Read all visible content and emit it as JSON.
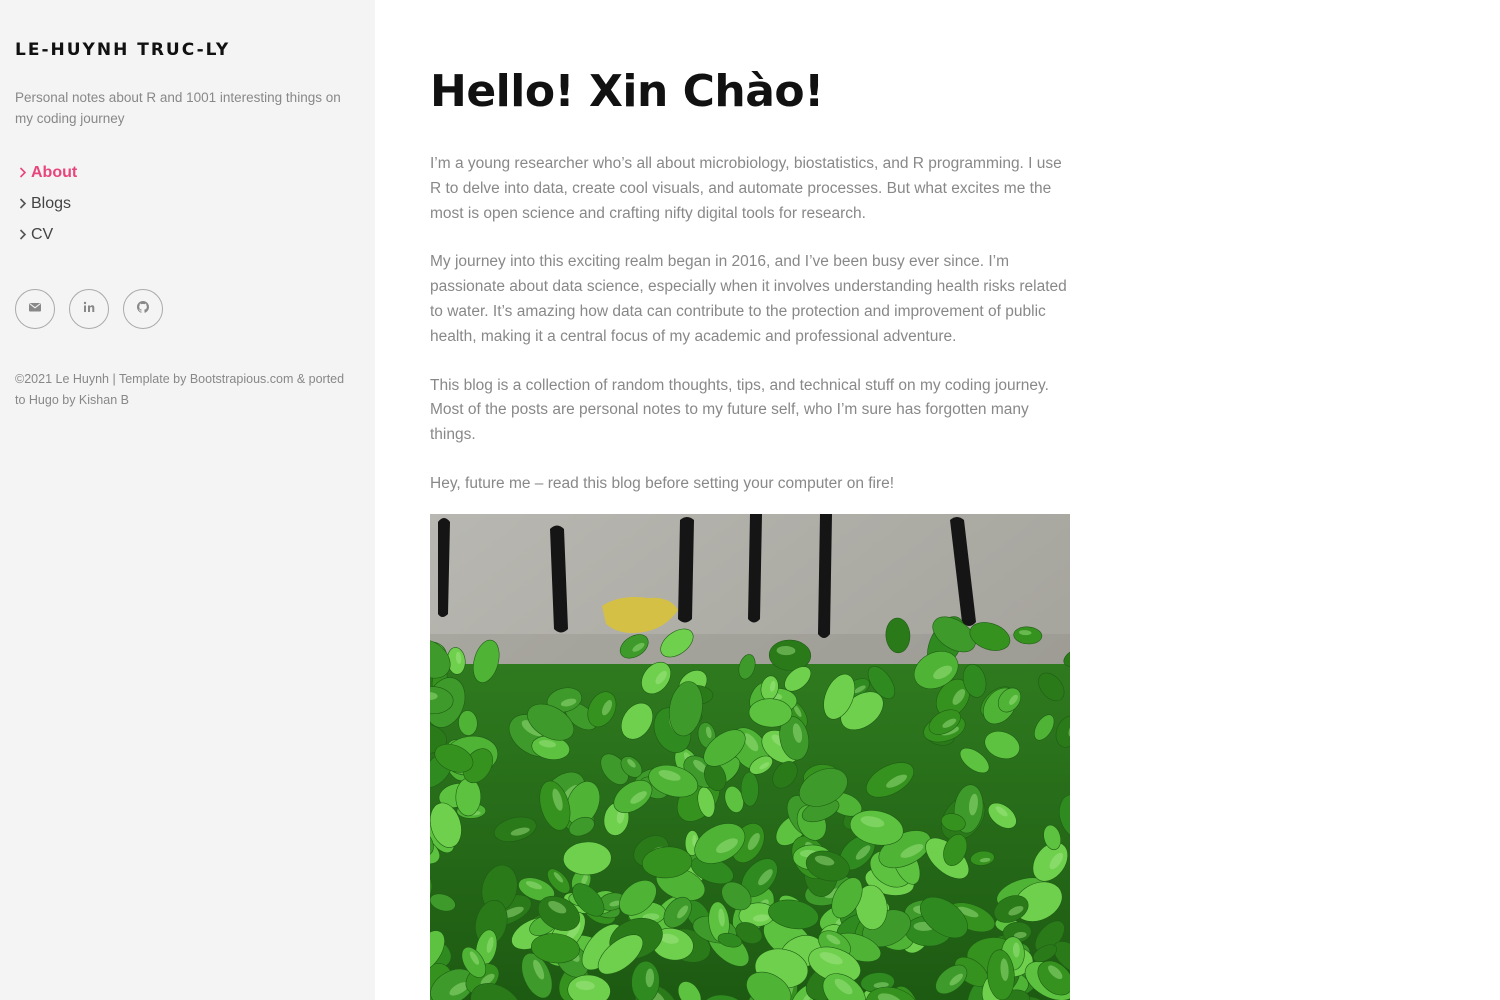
{
  "sidebar": {
    "site_title": "LE-HUYNH TRUC-LY",
    "tagline": "Personal notes about R and 1001 interesting things on my coding journey",
    "nav": [
      {
        "label": "About",
        "active": true
      },
      {
        "label": "Blogs",
        "active": false
      },
      {
        "label": "CV",
        "active": false
      }
    ],
    "social_icons": [
      "envelope-icon",
      "linkedin-icon",
      "github-icon"
    ],
    "footer": "©2021 Le Huynh | Template by Bootstrapious.com & ported to Hugo by Kishan B"
  },
  "main": {
    "title": "Hello! Xin Chào!",
    "paragraphs": [
      "I’m a young researcher who’s all about microbiology, biostatistics, and R programming. I use R to delve into data, create cool visuals, and automate processes. But what excites me the most is open science and crafting nifty digital tools for research.",
      "My journey into this exciting realm began in 2016, and I’ve been busy ever since. I’m passionate about data science, especially when it involves understanding health risks related to water. It’s amazing how data can contribute to the protection and improvement of public health, making it a central focus of my academic and professional adventure.",
      "This blog is a collection of random thoughts, tips, and technical stuff on my coding journey. Most of the posts are personal notes to my future self, who I’m sure has forgotten many things.",
      "Hey, future me – read this blog before setting your computer on fire!"
    ]
  },
  "colors": {
    "accent": "#e8457d",
    "sidebar_bg": "#f4f4f4",
    "text_muted": "#888888",
    "title": "#111111"
  }
}
